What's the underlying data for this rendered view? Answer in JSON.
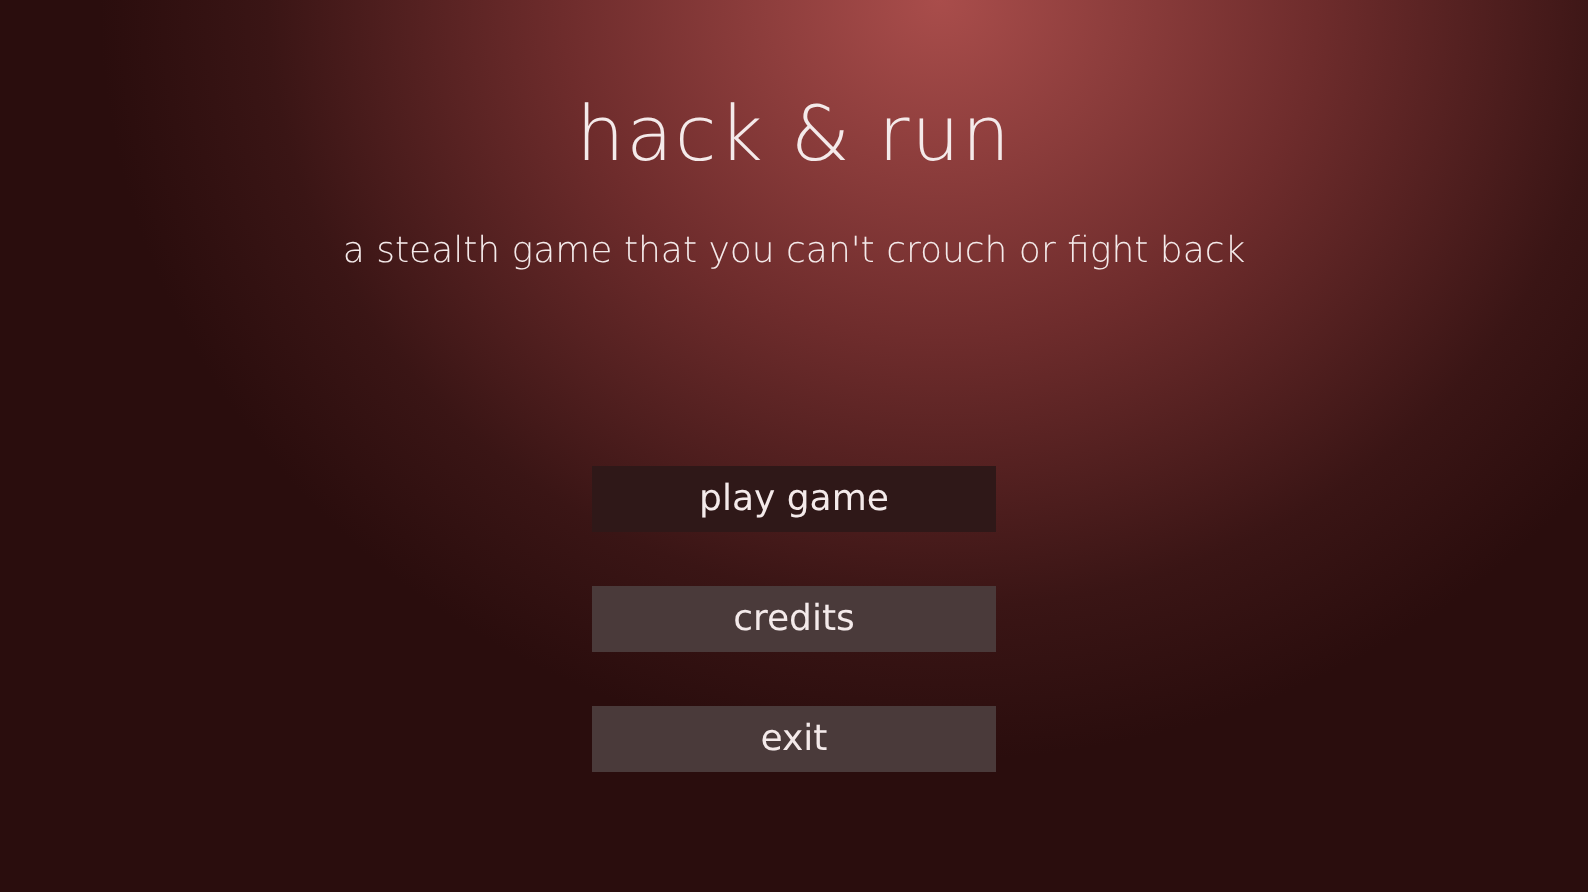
{
  "title": "hack & run",
  "subtitle": "a stealth game that you can't crouch or fight back",
  "menu": [
    {
      "label": "play game",
      "selected": true
    },
    {
      "label": "credits",
      "selected": false
    },
    {
      "label": "exit",
      "selected": false
    }
  ]
}
